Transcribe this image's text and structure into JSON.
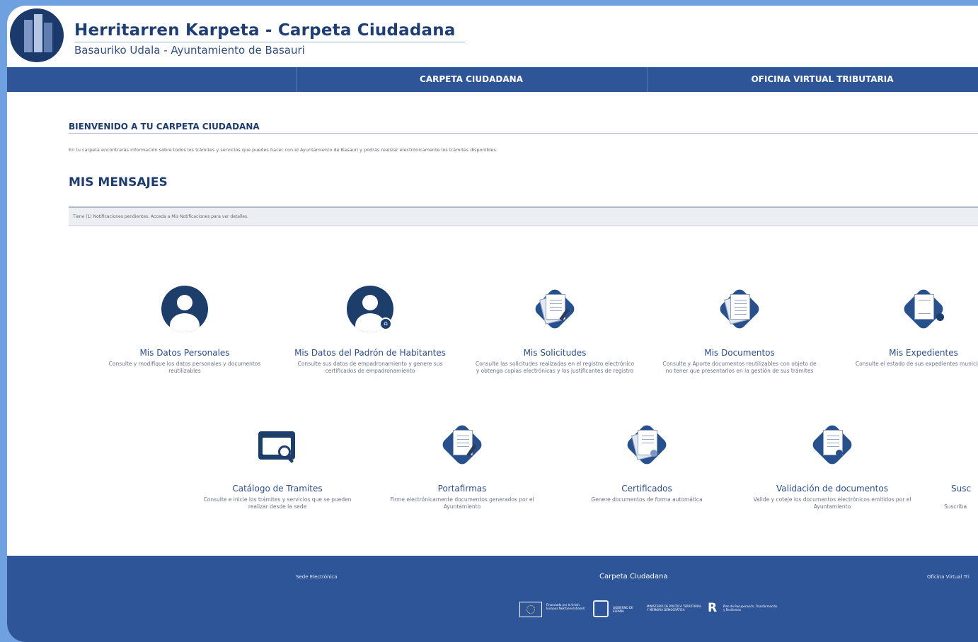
{
  "header": {
    "title": "Herritarren Karpeta - Carpeta Ciudadana",
    "subtitle": "Basauriko Udala - Ayuntamiento de Basauri"
  },
  "nav": {
    "items": [
      {
        "label": "CARPETA CIUDADANA"
      },
      {
        "label": "OFICINA VIRTUAL TRIBUTARIA"
      }
    ]
  },
  "welcome": {
    "title": "BIENVENIDO A TU CARPETA CIUDADANA",
    "text": "En tu carpeta encontrarás información sobre todos los trámites y servicios que puedes hacer con el Ayuntamiento de Basauri y podrás realizar electrónicamente los trámites disponibles."
  },
  "messages": {
    "heading": "MIS MENSAJES",
    "notice": "Tiene (1) Notificaciones pendientes. Acceda a Mis Notificaciones para ver detalles."
  },
  "cards_row1": [
    {
      "icon": "user-icon",
      "title": "Mis Datos Personales",
      "desc": "Consulte y modifique los datos personales y documentos reutilizables"
    },
    {
      "icon": "user-home-icon",
      "title": "Mis Datos del Padrón de Habitantes",
      "desc": "Consulte sus datos de empadronamiento y genere sus certificados de empadronamiento"
    },
    {
      "icon": "request-document-icon",
      "title": "Mis Solicitudes",
      "desc": "Consulte las solicitudes realizadas en el registro electrónico y obtenga copias electrónicas y los justificantes de registro"
    },
    {
      "icon": "documents-icon",
      "title": "Mis Documentos",
      "desc": "Consulte y Aporte documentos reutilizables con objeto de no tener que presentarlos en la gestión de sus trámites"
    },
    {
      "icon": "file-icon",
      "title": "Mis Expedientes",
      "desc": "Consulte el estado de sus expedientes municipales"
    }
  ],
  "cards_row2": [
    {
      "icon": "catalog-search-icon",
      "title": "Catálogo de Tramites",
      "desc": "Consulte e inicie los trámites y servicios que se pueden realizar desde la sede"
    },
    {
      "icon": "signature-icon",
      "title": "Portafirmas",
      "desc": "Firme electrónicamente documentos generados por el Ayuntamiento"
    },
    {
      "icon": "certificate-icon",
      "title": "Certificados",
      "desc": "Genere documentos de forma automática"
    },
    {
      "icon": "validation-icon",
      "title": "Validación de documentos",
      "desc": "Valide y coteje los documentos electrónicos emitidos por el Ayuntamiento"
    },
    {
      "icon": "subscription-icon",
      "title": "Susc",
      "desc": "Suscriba"
    }
  ],
  "footer": {
    "links": [
      "Sede Electrónica",
      "Carpeta Ciudadana",
      "Oficina Virtual Tri"
    ],
    "funding": [
      "Financiado por la Unión Europea NextGenerationEU",
      "GOBIERNO DE ESPAÑA",
      "MINISTERIO DE POLÍTICA TERRITORIAL Y MEMORIA DEMOCRÁTICA",
      "Plan de Recuperación, Transformación y Resiliencia"
    ]
  }
}
